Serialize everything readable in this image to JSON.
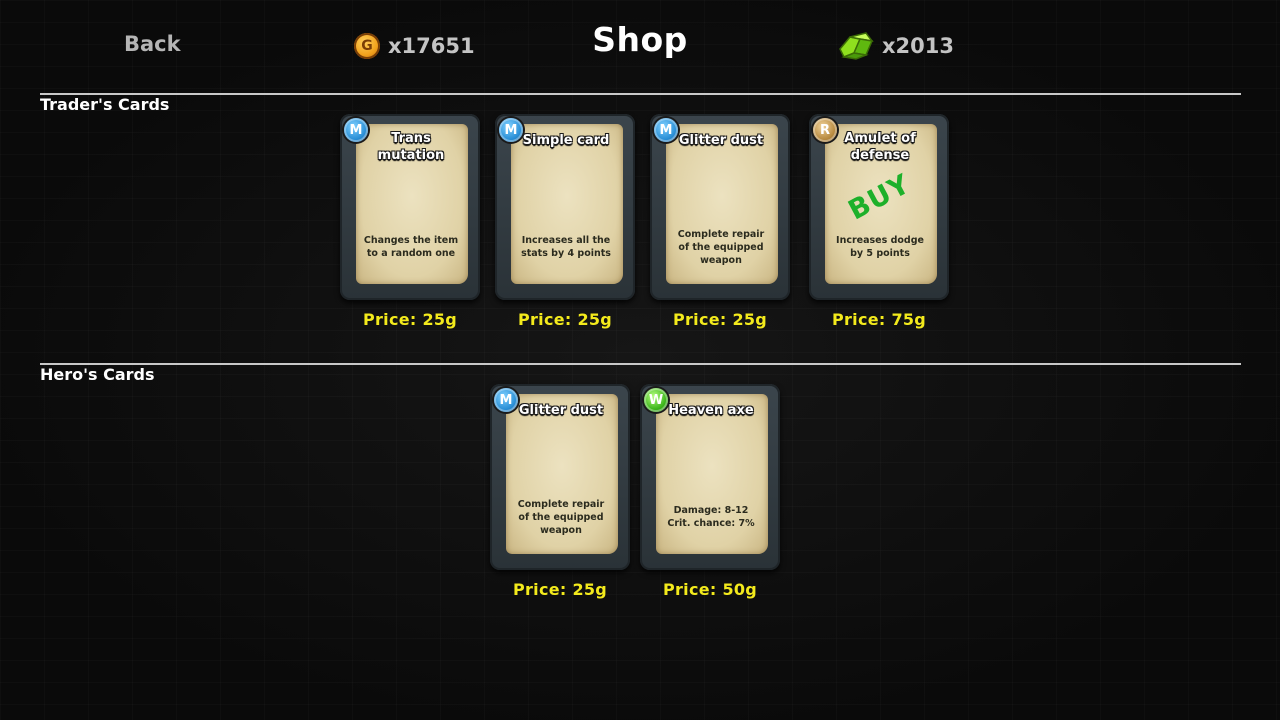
{
  "header": {
    "back_label": "Back",
    "title": "Shop",
    "gold": {
      "icon": "gold-coin-icon",
      "icon_letter": "G",
      "amount": "x17651"
    },
    "gems": {
      "icon": "green-crystal-icon",
      "amount": "x2013"
    }
  },
  "sections": {
    "trader": {
      "title": "Trader's Cards",
      "cards": [
        {
          "badge": "M",
          "badge_type": "mage",
          "title_line1": "Trans",
          "title_line2": "mutation",
          "desc_line1": "Changes the item",
          "desc_line2": "to a random one",
          "desc_line3": "",
          "price": "Price: 25g"
        },
        {
          "badge": "M",
          "badge_type": "mage",
          "title_line1": "Simple card",
          "title_line2": "",
          "desc_line1": "Increases all the",
          "desc_line2": "stats by 4 points",
          "desc_line3": "",
          "price": "Price: 25g"
        },
        {
          "badge": "M",
          "badge_type": "mage",
          "title_line1": "Glitter dust",
          "title_line2": "",
          "desc_line1": "Complete repair",
          "desc_line2": "of the equipped",
          "desc_line3": "weapon",
          "price": "Price: 25g"
        },
        {
          "badge": "R",
          "badge_type": "rogue",
          "title_line1": "Amulet of",
          "title_line2": "defense",
          "stamp": "BUY",
          "desc_line1": "Increases dodge",
          "desc_line2": "by 5 points",
          "desc_line3": "",
          "price": "Price: 75g"
        }
      ]
    },
    "hero": {
      "title": "Hero's Cards",
      "cards": [
        {
          "badge": "M",
          "badge_type": "mage",
          "title_line1": "Glitter dust",
          "title_line2": "",
          "desc_line1": "Complete repair",
          "desc_line2": "of the equipped",
          "desc_line3": "weapon",
          "price": "Price: 25g"
        },
        {
          "badge": "W",
          "badge_type": "warrior",
          "title_line1": "Heaven axe",
          "title_line2": "",
          "desc_line1": "Damage: 8-12",
          "desc_line2": "Crit. chance: 7%",
          "desc_line3": "",
          "price": "Price: 50g"
        }
      ]
    }
  },
  "colors": {
    "price_yellow": "#f3ea1c",
    "buy_green": "#1db02a",
    "badge_mage": "#2a8fd6",
    "badge_rogue": "#b88a3f",
    "badge_warrior": "#3bb51a"
  }
}
